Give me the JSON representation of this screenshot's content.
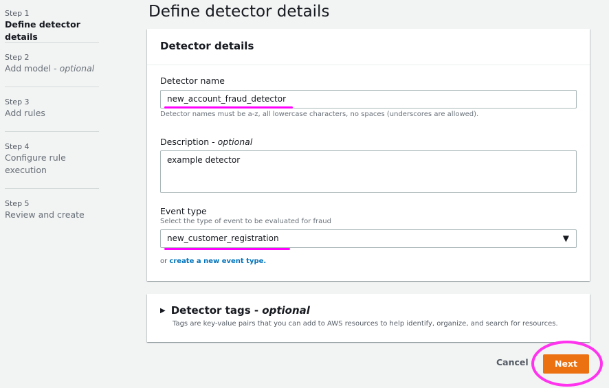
{
  "steps": [
    {
      "num": "Step 1",
      "label": "Define detector details",
      "active": true
    },
    {
      "num": "Step 2",
      "label": "Add model - ",
      "optional": "optional"
    },
    {
      "num": "Step 3",
      "label": "Add rules"
    },
    {
      "num": "Step 4",
      "label": "Configure rule execution"
    },
    {
      "num": "Step 5",
      "label": "Review and create"
    }
  ],
  "page_title": "Define detector details",
  "detector_panel": {
    "title": "Detector details",
    "name": {
      "label": "Detector name",
      "value": "new_account_fraud_detector",
      "hint": "Detector names must be a-z, all lowercase characters, no spaces (underscores are allowed)."
    },
    "description": {
      "label": "Description - ",
      "optional": "optional",
      "value": "example detector"
    },
    "event_type": {
      "label": "Event type",
      "hint": "Select the type of event to be evaluated for fraud",
      "selected": "new_customer_registration",
      "or_text": "or ",
      "create_link": "create a new event type."
    }
  },
  "tags_panel": {
    "title": "Detector tags - ",
    "optional": "optional",
    "description": "Tags are key-value pairs that you can add to AWS resources to help identify, organize, and search for resources."
  },
  "footer": {
    "cancel_label": "Cancel",
    "next_label": "Next"
  },
  "colors": {
    "primary_button": "#ec7211",
    "link": "#0073bb",
    "annotation": "#ff00ff"
  },
  "icons": {
    "dropdown": "caret-down-icon",
    "expand": "caret-right-icon"
  }
}
